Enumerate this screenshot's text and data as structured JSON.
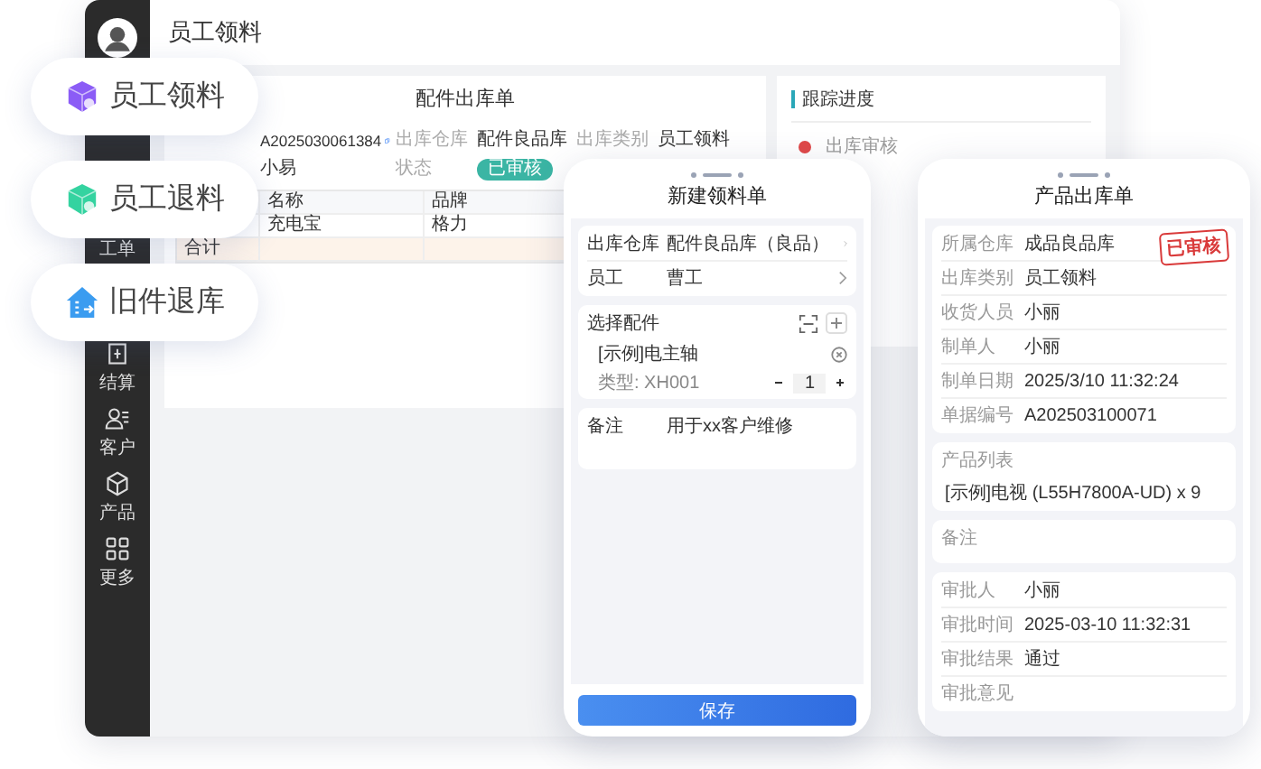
{
  "window": {
    "title": "员工领料"
  },
  "sidebar": {
    "items": [
      {
        "label": "工单"
      },
      {
        "label": "结算"
      },
      {
        "label": "客户"
      },
      {
        "label": "产品"
      },
      {
        "label": "更多"
      }
    ]
  },
  "order": {
    "title": "配件出库单",
    "fields": [
      {
        "kind": "copyable",
        "value": "A2025030061384"
      },
      {
        "kind": "text",
        "label": "出库仓库",
        "value": "配件良品库"
      },
      {
        "kind": "text",
        "label": "出库类别",
        "value": "员工领料"
      },
      {
        "kind": "text",
        "value": "小易"
      },
      {
        "kind": "badge",
        "label": "状态",
        "value": "已审核"
      }
    ],
    "table": {
      "columns": [
        "名称",
        "品牌"
      ],
      "rows": [
        {
          "kind": "item",
          "cells": [
            "充电宝",
            "格力"
          ]
        },
        {
          "kind": "total",
          "label": "合计"
        }
      ]
    }
  },
  "tracking": {
    "title": "跟踪进度",
    "steps": [
      {
        "title": "出库审核"
      }
    ]
  },
  "pills": [
    {
      "label": "员工领料",
      "color": "#8b5cf6"
    },
    {
      "label": "员工退料",
      "color": "#34d3a0"
    },
    {
      "label": "旧件退库",
      "color": "#3b9cf0"
    }
  ],
  "new_form": {
    "title": "新建领料单",
    "rows": [
      {
        "label": "出库仓库",
        "value": "配件良品库（良品）"
      },
      {
        "label": "员工",
        "value": "曹工"
      }
    ],
    "parts": {
      "title": "选择配件",
      "items": [
        {
          "name": "[示例]电主轴",
          "model": "类型: XH001",
          "qty": "1"
        }
      ]
    },
    "note": {
      "label": "备注",
      "value": "用于xx客户维修"
    },
    "save": "保存"
  },
  "out_form": {
    "title": "产品出库单",
    "stamp": "已审核",
    "info": [
      {
        "label": "所属仓库",
        "value": "成品良品库"
      },
      {
        "label": "出库类别",
        "value": "员工领料"
      },
      {
        "label": "收货人员",
        "value": "小丽"
      },
      {
        "label": "制单人",
        "value": "小丽"
      },
      {
        "label": "制单日期",
        "value": "2025/3/10 11:32:24"
      },
      {
        "label": "单据编号",
        "value": "A202503100071"
      }
    ],
    "products": {
      "label": "产品列表",
      "items": [
        "[示例]电视 (L55H7800A-UD) x 9"
      ]
    },
    "note": {
      "label": "备注"
    },
    "approval": [
      {
        "label": "审批人",
        "value": "小丽"
      },
      {
        "label": "审批时间",
        "value": "2025-03-10 11:32:31"
      },
      {
        "label": "审批结果",
        "value": "通过"
      },
      {
        "label": "审批意见"
      }
    ]
  }
}
